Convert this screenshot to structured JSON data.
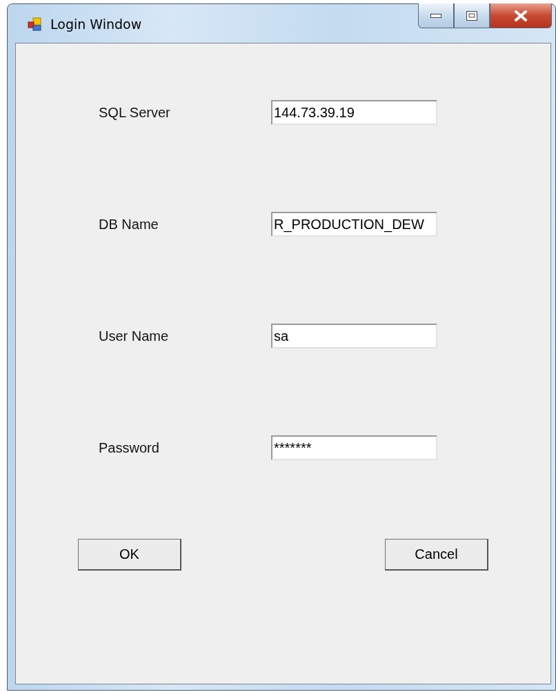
{
  "window": {
    "title": "Login Window"
  },
  "fields": [
    {
      "label": "SQL Server",
      "value": "144.73.39.19"
    },
    {
      "label": "DB Name",
      "value": "R_PRODUCTION_DEW"
    },
    {
      "label": "User Name",
      "value": "sa"
    },
    {
      "label": "Password",
      "value": "*******"
    }
  ],
  "buttons": [
    "OK",
    "Cancel"
  ]
}
